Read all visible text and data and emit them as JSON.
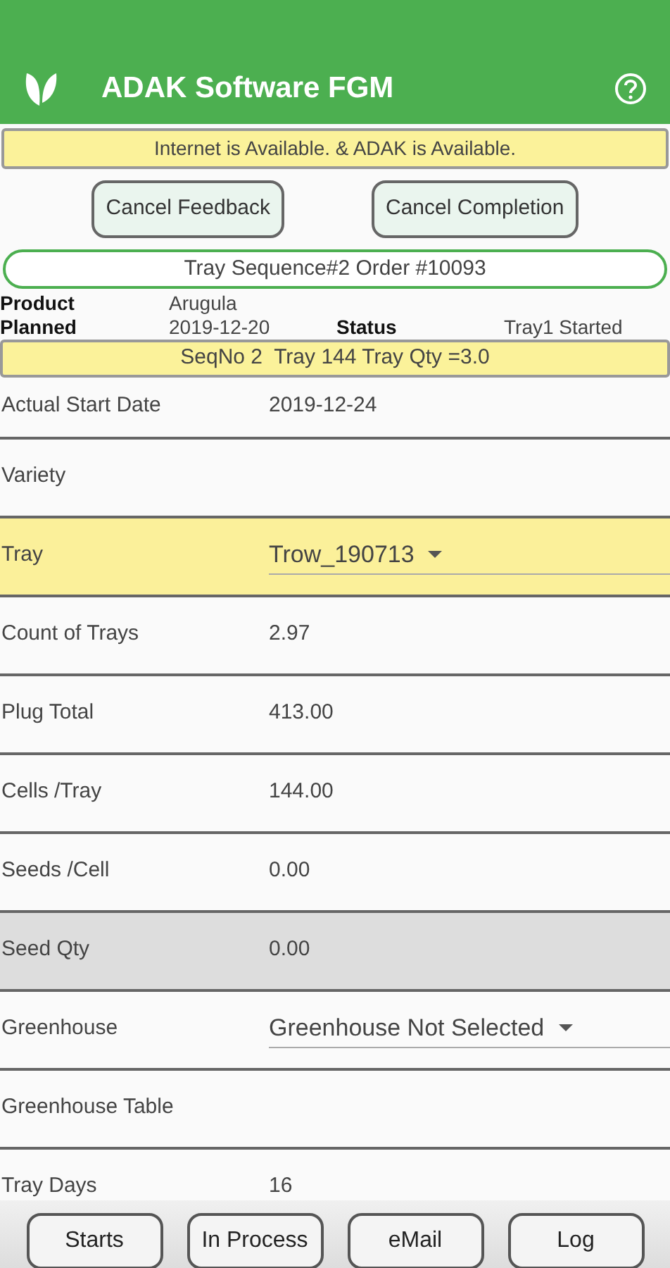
{
  "app_bar": {
    "title": "ADAK Software FGM"
  },
  "connection_banner": "Internet is Available. & ADAK is Available.",
  "actions": [
    "Cancel Feedback",
    "Cancel Completion"
  ],
  "sequence_title": "Tray Sequence#2 Order #10093",
  "summary": {
    "product_label": "Product",
    "product": "Arugula",
    "planned_label": "Planned",
    "planned": "2019-12-20",
    "status_label": "Status",
    "status": "Tray1 Started"
  },
  "sequence_banner": "SeqNo 2  Tray 144 Tray Qty =3.0",
  "fields": [
    {
      "kind": "text",
      "label": "Actual Start Date",
      "value": "2019-12-24",
      "highlighted": false
    },
    {
      "kind": "text",
      "label": "Variety",
      "highlighted": false
    },
    {
      "kind": "dropdown",
      "label": "Tray",
      "value": "Trow_190713",
      "highlighted": true,
      "color": "#fbf09a"
    },
    {
      "kind": "text",
      "label": "Count of Trays",
      "value": "2.97",
      "highlighted": false
    },
    {
      "kind": "text",
      "label": "Plug Total",
      "value": "413.00",
      "highlighted": false
    },
    {
      "kind": "text",
      "label": "Cells /Tray",
      "value": "144.00",
      "highlighted": false
    },
    {
      "kind": "text",
      "label": "Seeds /Cell",
      "value": "0.00",
      "highlighted": false
    },
    {
      "kind": "text",
      "label": "Seed Qty",
      "value": "0.00",
      "highlighted": true,
      "color": "#dddddd"
    },
    {
      "kind": "dropdown",
      "label": "Greenhouse",
      "value": "Greenhouse Not Selected",
      "highlighted": false
    },
    {
      "kind": "text",
      "label": "Greenhouse Table",
      "highlighted": false
    },
    {
      "kind": "text",
      "label": "Tray Days",
      "value": "16",
      "highlighted": false
    }
  ],
  "bottom_buttons": [
    "Starts",
    "In Process",
    "eMail",
    "Log"
  ]
}
